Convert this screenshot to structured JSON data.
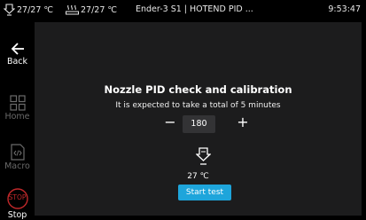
{
  "colors": {
    "background": "#000000",
    "panel": "#1c1c1d",
    "accent": "#1ea5db",
    "stop_red": "#c0282a",
    "dim_icon": "#6a6a6a"
  },
  "statusbar": {
    "nozzle_icon": "nozzle-icon",
    "nozzle_temp": "27/27 ℃",
    "bed_icon": "heated-bed-icon",
    "bed_temp": "27/27 ℃",
    "title": "Ender-3 S1 | HOTEND PID ...",
    "time": "9:53:47"
  },
  "sidebar": {
    "items": [
      {
        "label": "Back",
        "icon": "back-arrow-icon"
      },
      {
        "label": "Home",
        "icon": "home-grid-icon"
      },
      {
        "label": "Macro",
        "icon": "macro-icon"
      },
      {
        "label": "Stop",
        "icon": "stop-icon",
        "badge": "STOP"
      }
    ]
  },
  "main": {
    "title": "Nozzle PID check and calibration",
    "subtitle": "It is expected to take a total of 5 minutes",
    "decrement_label": "−",
    "target_temp": "180",
    "increment_label": "+",
    "nozzle_icon": "nozzle-icon",
    "current_temp": "27 ℃",
    "start_label": "Start test"
  }
}
